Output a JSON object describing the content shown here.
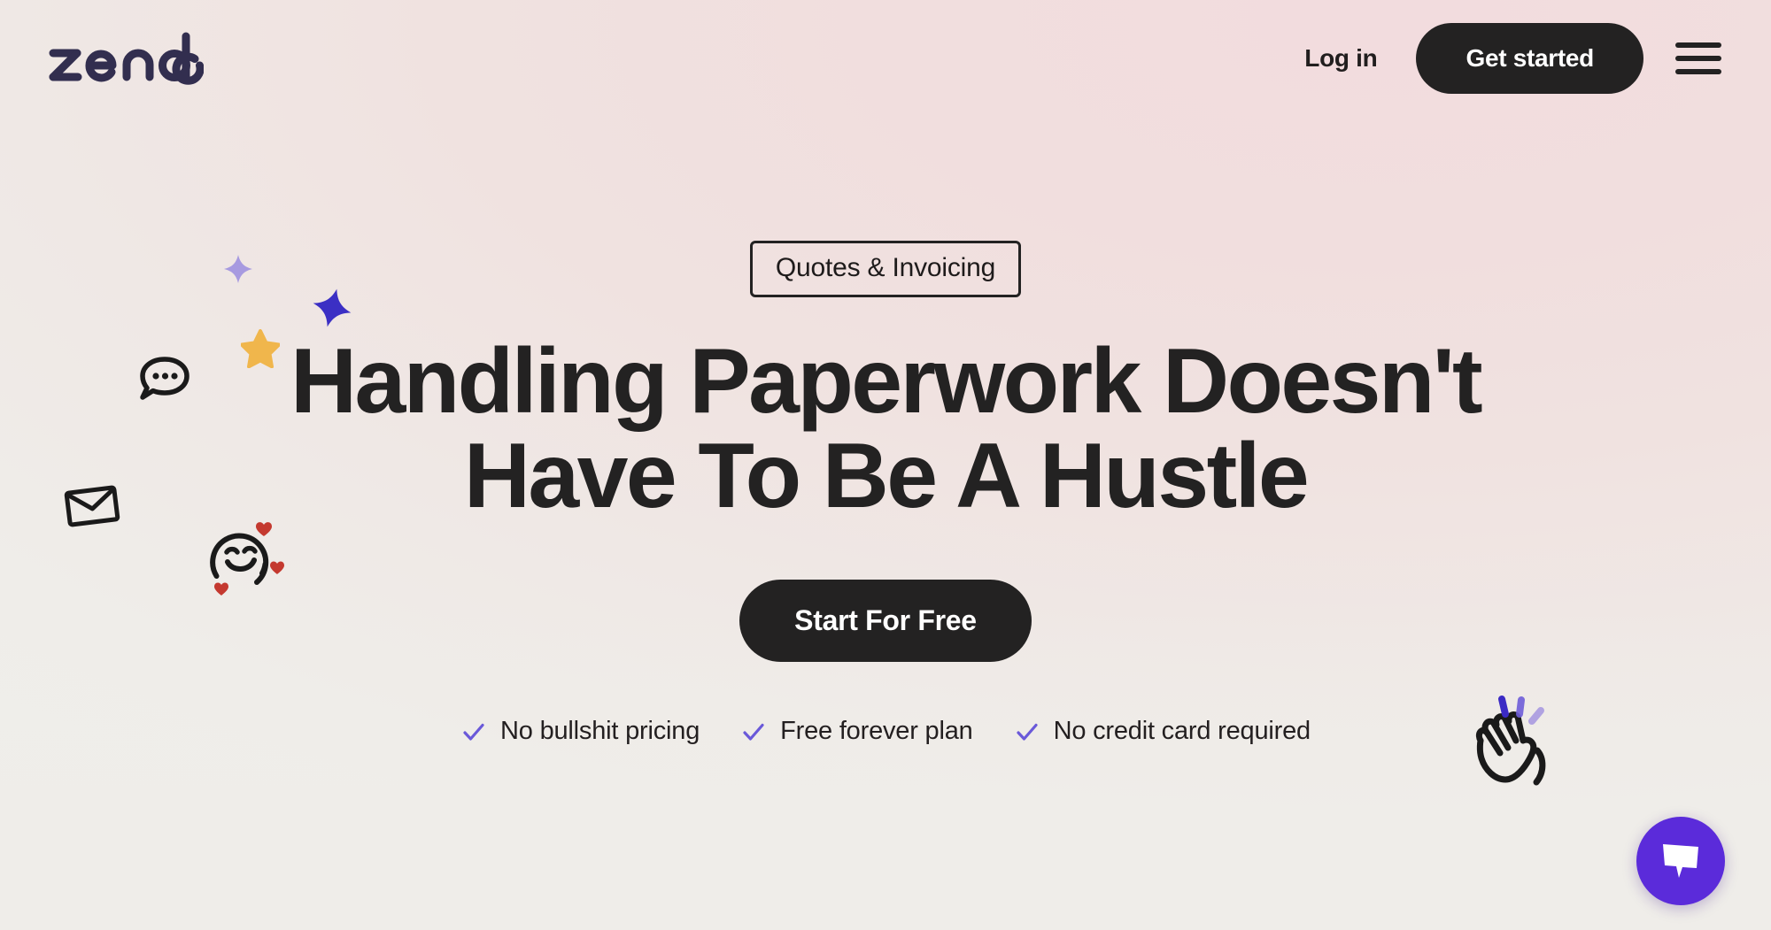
{
  "brand": {
    "name": "zendo",
    "logo_color": "#322E4F"
  },
  "header": {
    "login_label": "Log in",
    "get_started_label": "Get started",
    "menu_icon": "hamburger-menu-icon"
  },
  "hero": {
    "badge_label": "Quotes & Invoicing",
    "headline_line1": "Handling Paperwork Doesn't",
    "headline_line2": "Have To Be A Hustle",
    "cta_label": "Start For Free",
    "features": [
      {
        "label": "No bullshit pricing",
        "icon": "check-icon"
      },
      {
        "label": "Free forever plan",
        "icon": "check-icon"
      },
      {
        "label": "No credit card required",
        "icon": "check-icon"
      }
    ]
  },
  "decorations": [
    {
      "icon": "sparkle-icon",
      "color": "#A79AE0"
    },
    {
      "icon": "star-four-point-icon",
      "color": "#3B2FC4"
    },
    {
      "icon": "star-five-point-icon",
      "color": "#F0B64C"
    },
    {
      "icon": "chat-bubble-icon",
      "color": "#1A1A1A"
    },
    {
      "icon": "envelope-icon",
      "color": "#1A1A1A"
    },
    {
      "icon": "smiley-hearts-icon",
      "color": "#1A1A1A",
      "heart_color": "#C4392F"
    },
    {
      "icon": "waving-hand-icon",
      "color": "#1A1A1A",
      "motion_color": "#4B2FD0"
    }
  ],
  "chat_widget": {
    "icon": "chat-bubble-icon",
    "background": "#5B2BDA"
  },
  "colors": {
    "accent_purple": "#6A59D9",
    "dark": "#232222",
    "bg_left": "#EFEDE9",
    "bg_right": "#F2DCDE"
  }
}
